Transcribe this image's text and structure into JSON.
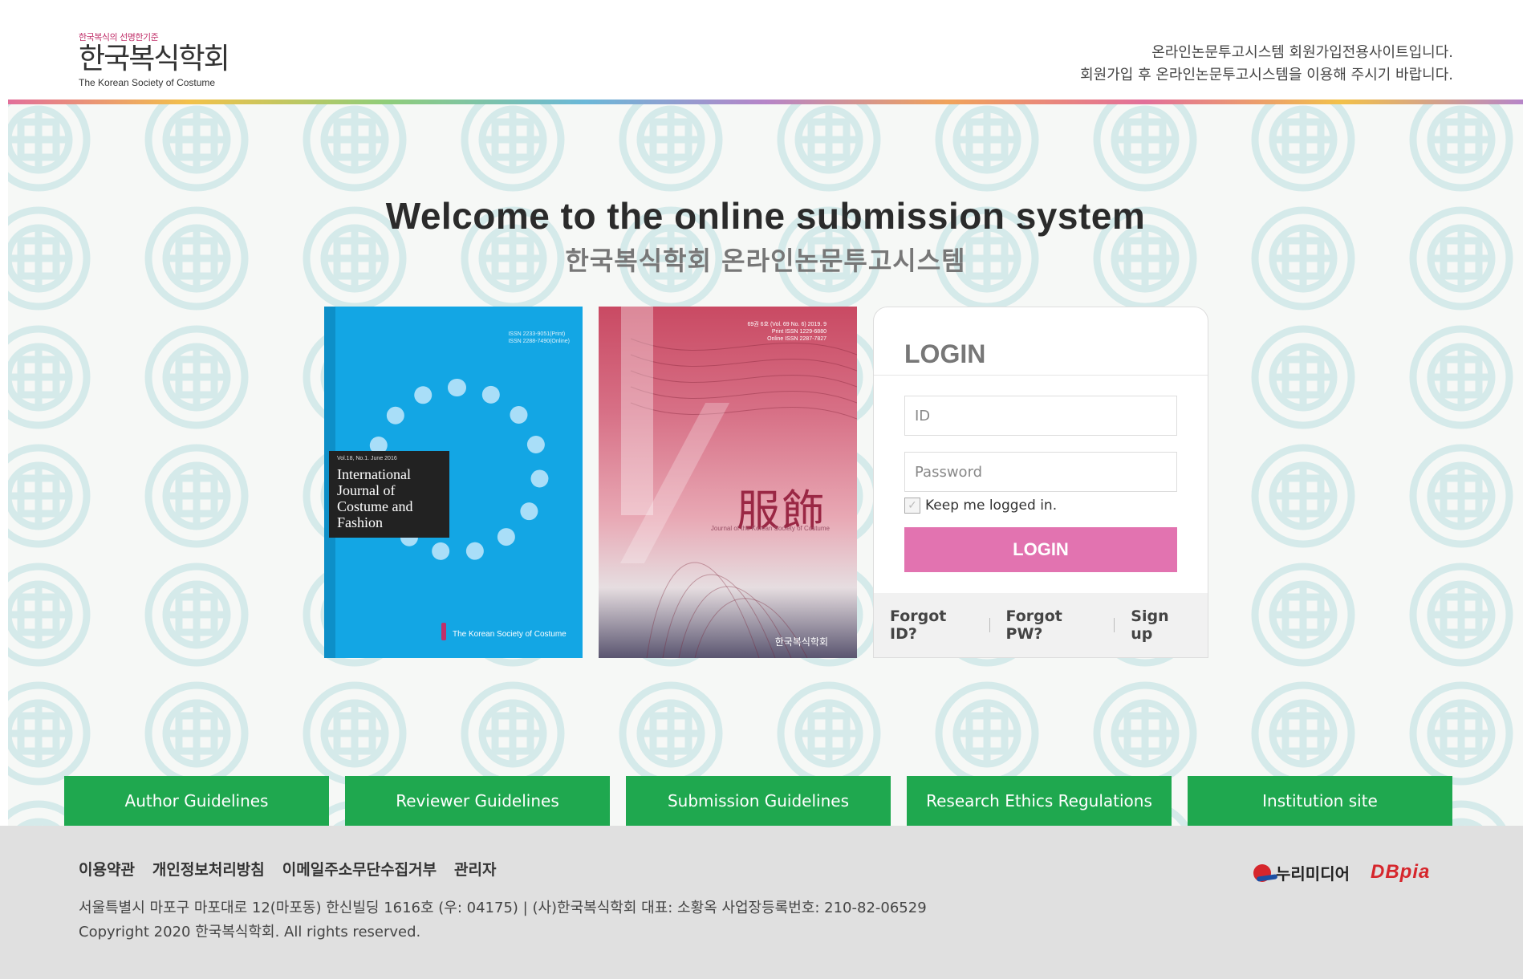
{
  "header": {
    "logo_tagline": "한국복식의 선명한기준",
    "logo_title": "한국복식학회",
    "logo_subtitle": "The Korean Society of Costume",
    "notice_line1": "온라인논문투고시스템 회원가입전용사이트입니다.",
    "notice_line2": "회원가입 후 온라인논문투고시스템을 이용해 주시기 바랍니다."
  },
  "hero": {
    "title": "Welcome to the online submission system",
    "subtitle": "한국복식학회 온라인논문투고시스템"
  },
  "covers": {
    "ijcf": {
      "issn_print": "ISSN 2233-9051(Print)",
      "issn_online": "ISSN 2288-7490(Online)",
      "volume": "Vol.18, No.1. June 2016",
      "title": "International Journal of Costume and Fashion",
      "society": "The Korean Society of Costume"
    },
    "bokshik": {
      "volume": "69권 6호 (Vol. 69 No. 6) 2019. 9",
      "issn_print": "Print ISSN 1229-6880",
      "issn_online": "Online ISSN 2287-7827",
      "hanja": "服飾",
      "journal": "Journal of the Korean Society of Costume",
      "society": "한국복식학회"
    }
  },
  "login": {
    "heading": "LOGIN",
    "id_placeholder": "ID",
    "pw_placeholder": "Password",
    "keep_label": "Keep me logged in.",
    "button_label": "LOGIN",
    "forgot_id": "Forgot ID?",
    "forgot_pw": "Forgot PW?",
    "sign_up": "Sign up"
  },
  "guides": [
    {
      "label": "Author Guidelines"
    },
    {
      "label": "Reviewer Guidelines"
    },
    {
      "label": "Submission Guidelines"
    },
    {
      "label": "Research Ethics Regulations"
    },
    {
      "label": "Institution site"
    }
  ],
  "footer": {
    "links": [
      "이용약관",
      "개인정보처리방침",
      "이메일주소무단수집거부",
      "관리자"
    ],
    "address": "서울특별시 마포구 마포대로 12(마포동) 한신빌딩 1616호 (우: 04175) | (사)한국복식학회 대표: 소황옥 사업장등록번호: 210-82-06529",
    "copyright": "Copyright 2020 한국복식학회. All rights reserved.",
    "partner_nuri": "누리미디어",
    "partner_dbpia": "DBpia"
  },
  "colors": {
    "login_button": "#e273b0",
    "guide_button": "#1fa84f",
    "footer_bg": "#e0e0e0",
    "pattern": "#d8ecec"
  }
}
